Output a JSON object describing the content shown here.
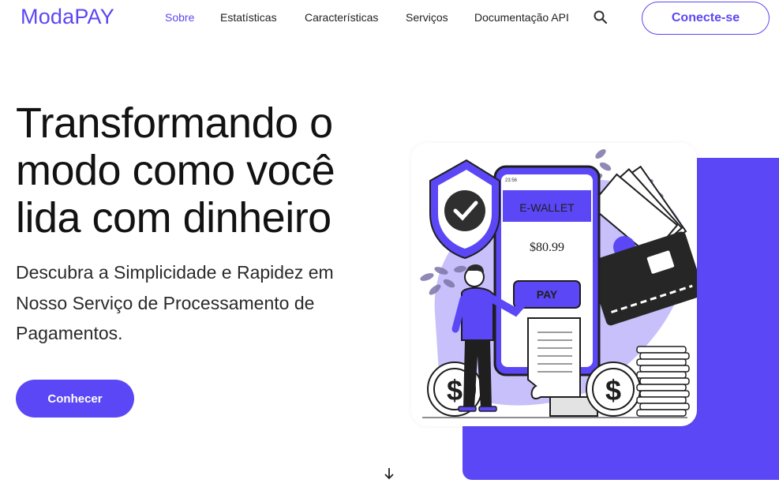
{
  "brand": {
    "name": "ModaPAY",
    "accent": "#5b47f5"
  },
  "nav": {
    "items": [
      {
        "label": "Sobre",
        "active": true
      },
      {
        "label": "Estatísticas",
        "active": false
      },
      {
        "label": "Características",
        "active": false
      },
      {
        "label": "Serviços",
        "active": false
      },
      {
        "label": "Documentação API",
        "active": false
      }
    ],
    "search_icon": "search-icon",
    "connect_label": "Conecte-se"
  },
  "hero": {
    "title": "Transformando o modo como você lida com dinheiro",
    "subtitle": "Descubra a Simplicidade e Rapidez em Nosso Serviço de Processamento de Pagamentos.",
    "cta_label": "Conhecer",
    "scroll_icon": "arrow-down-icon"
  },
  "illustration": {
    "phone_time": "23:56",
    "wallet_label": "E-WALLET",
    "amount": "$80.99",
    "pay_label": "PAY",
    "coin_symbol": "$"
  }
}
